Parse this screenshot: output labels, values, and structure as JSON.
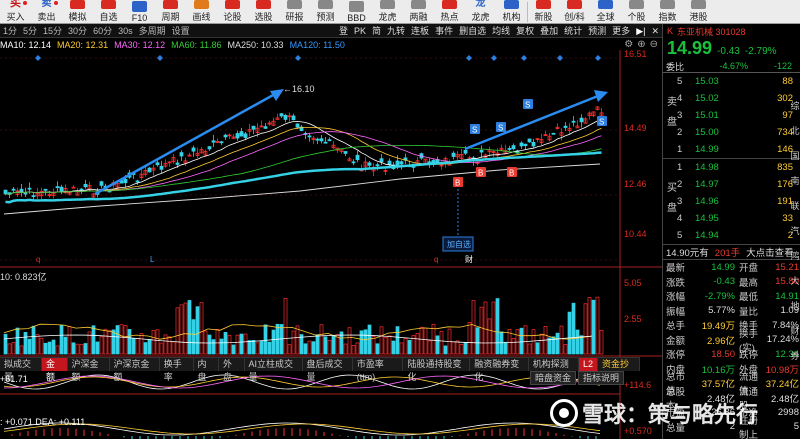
{
  "toolbar": {
    "items": [
      {
        "label": "买入",
        "icon": "buy-icon",
        "style": "txt",
        "glyph": "买"
      },
      {
        "label": "卖出",
        "icon": "sell-icon",
        "style": "txtb",
        "glyph": "卖"
      },
      {
        "label": "模拟",
        "icon": "simulate-icon",
        "style": "red",
        "glyph": ""
      },
      {
        "label": "自选",
        "icon": "watchlist-icon",
        "style": "red",
        "glyph": ""
      },
      {
        "label": "F10",
        "icon": "f10-icon",
        "style": "blue",
        "glyph": ""
      },
      {
        "label": "周期",
        "icon": "period-icon",
        "style": "red",
        "glyph": ""
      },
      {
        "label": "画线",
        "icon": "draw-line-icon",
        "style": "orange",
        "glyph": ""
      },
      {
        "label": "论股",
        "icon": "discuss-icon",
        "style": "red",
        "glyph": ""
      },
      {
        "label": "选股",
        "icon": "stock-pick-icon",
        "style": "red",
        "glyph": ""
      },
      {
        "label": "研报",
        "icon": "research-report-icon",
        "style": "gray",
        "glyph": ""
      },
      {
        "label": "预测",
        "icon": "forecast-icon",
        "style": "gray",
        "glyph": ""
      },
      {
        "label": "BBD",
        "icon": "bbd-icon",
        "style": "gray",
        "glyph": ""
      },
      {
        "label": "龙虎",
        "icon": "dragon-tiger-icon",
        "style": "gray",
        "glyph": ""
      },
      {
        "label": "两融",
        "icon": "margin-icon",
        "style": "gray",
        "glyph": ""
      },
      {
        "label": "热点",
        "icon": "hotspot-icon",
        "style": "red",
        "glyph": ""
      },
      {
        "label": "龙虎",
        "icon": "dragon-icon",
        "style": "txtb",
        "glyph": "龙"
      },
      {
        "label": "机构",
        "icon": "institution-icon",
        "style": "blue",
        "glyph": ""
      },
      {
        "label": "",
        "icon": "sep-icon",
        "style": "none",
        "glyph": ""
      },
      {
        "label": "新股",
        "icon": "new-stock-icon",
        "style": "red",
        "glyph": ""
      },
      {
        "label": "创/科",
        "icon": "star-board-icon",
        "style": "red",
        "glyph": ""
      },
      {
        "label": "全球",
        "icon": "global-icon",
        "style": "blue",
        "glyph": ""
      },
      {
        "label": "个股",
        "icon": "single-stock-icon",
        "style": "gray",
        "glyph": ""
      },
      {
        "label": "指数",
        "icon": "index-icon",
        "style": "gray",
        "glyph": ""
      },
      {
        "label": "港股",
        "icon": "hk-stock-icon",
        "style": "gray",
        "glyph": ""
      }
    ]
  },
  "periods": [
    "1分",
    "5分",
    "15分",
    "30分",
    "60分",
    "30s",
    "多周期",
    "设置"
  ],
  "active_period": "日",
  "tools": [
    "登",
    "PK",
    "简",
    "九转",
    "连板",
    "事件",
    "删自选",
    "均线",
    "复权",
    "叠加",
    "统计",
    "预测",
    "更多"
  ],
  "ma": [
    {
      "label": "MA10: 12.14",
      "color": "#ffffff"
    },
    {
      "label": "MA20: 12.31",
      "color": "#ffcc33"
    },
    {
      "label": "MA30: 12.12",
      "color": "#ff66ff"
    },
    {
      "label": "MA60: 11.86",
      "color": "#33cc33"
    },
    {
      "label": "MA250: 10.33",
      "color": "#dddddd"
    },
    {
      "label": "MA120: 11.50",
      "color": "#3399ff"
    }
  ],
  "price_axis": [
    "16.51",
    "14.49",
    "12.46",
    "10.44"
  ],
  "annotations": {
    "high": "16.10",
    "join": "加自选",
    "s": "S",
    "b": "B",
    "q": "q",
    "l": "L",
    "cai": "财"
  },
  "vol": {
    "label": "10: 0.823亿",
    "axis_top": "5.05",
    "axis_mid": "2.55"
  },
  "tabs": [
    "拟成交量",
    "金额",
    "沪深金额",
    "沪深京金额",
    "换手率",
    "内盘",
    "外盘",
    "AI立柱成交量",
    "盘后成交量",
    "市盈率(ttm)",
    "陆股通持股变化",
    "融资融券变化",
    "机构探测器",
    "资金抄底"
  ],
  "active_tab": "金额",
  "sub_buttons": [
    "暗盘资金",
    "指标说明"
  ],
  "ind1": {
    "label": "+61.71",
    "right": "+114.6"
  },
  "ind2": {
    "label": ": +0.071  DEA: +0.111",
    "right": "+0.570"
  },
  "quote": {
    "name": "东亚机械 301028",
    "price": "14.99",
    "change": "-0.43",
    "pct": "-2.79%",
    "ratio_label": "委比",
    "ratio": "-4.67%",
    "diff": "-122",
    "sell_label": "卖盘",
    "buy_label": "买盘",
    "sells": [
      {
        "lv": "5",
        "p": "15.03",
        "v": "88"
      },
      {
        "lv": "4",
        "p": "15.02",
        "v": "302"
      },
      {
        "lv": "3",
        "p": "15.01",
        "v": "97"
      },
      {
        "lv": "2",
        "p": "15.00",
        "v": "734"
      },
      {
        "lv": "1",
        "p": "14.99",
        "v": "146"
      }
    ],
    "buys": [
      {
        "lv": "1",
        "p": "14.98",
        "v": "835"
      },
      {
        "lv": "2",
        "p": "14.97",
        "v": "176"
      },
      {
        "lv": "3",
        "p": "14.96",
        "v": "191"
      },
      {
        "lv": "4",
        "p": "14.95",
        "v": "33"
      },
      {
        "lv": "5",
        "p": "14.94",
        "v": "2"
      }
    ],
    "trade": {
      "price": "14.90元有",
      "vol": "201手",
      "link": "大点击查看"
    },
    "stats": [
      {
        "k": "最新",
        "v": "14.99",
        "vc": "g",
        "k2": "开盘",
        "v2": "15.21",
        "v2c": "r"
      },
      {
        "k": "涨跌",
        "v": "-0.43",
        "vc": "g",
        "k2": "最高",
        "v2": "15.80",
        "v2c": "r"
      },
      {
        "k": "涨幅",
        "v": "-2.79%",
        "vc": "g",
        "k2": "最低",
        "v2": "14.91",
        "v2c": "g"
      },
      {
        "k": "振幅",
        "v": "5.77%",
        "vc": "w",
        "k2": "量比",
        "v2": "1.09",
        "v2c": "w"
      },
      {
        "k": "总手",
        "v": "19.49万",
        "vc": "y",
        "k2": "换手",
        "v2": "7.84%",
        "v2c": "w"
      },
      {
        "k": "金额",
        "v": "2.96亿",
        "vc": "y",
        "k2": "换手(实)",
        "v2": "17.24%",
        "v2c": "w"
      },
      {
        "k": "涨停",
        "v": "18.50",
        "vc": "r",
        "k2": "跌停",
        "v2": "12.34",
        "v2c": "g"
      },
      {
        "k": "内盘",
        "v": "10.16万",
        "vc": "g",
        "k2": "外盘",
        "v2": "10.98万",
        "v2c": "r"
      },
      {
        "k": "总市值",
        "v": "37.57亿",
        "vc": "y",
        "k2": "流通值",
        "v2": "37.24亿",
        "v2c": "y"
      },
      {
        "k": "总股本",
        "v": "2.48亿",
        "vc": "w",
        "k2": "流通股",
        "v2": "2.48亿",
        "v2c": "w"
      },
      {
        "k": "市盈",
        "v": "26.86",
        "vc": "w",
        "k2": "市净",
        "v2": "2998",
        "v2c": "w"
      },
      {
        "k": "总量",
        "v": "2",
        "vc": "w",
        "k2": "注册制上",
        "v2": "5",
        "v2c": "w"
      }
    ]
  },
  "side_strip": [
    "综",
    "北",
    "国",
    "南",
    "联",
    "汽",
    "鸿",
    "大",
    "地",
    "财",
    "券"
  ],
  "watermark": "雪球：策与略先行"
}
